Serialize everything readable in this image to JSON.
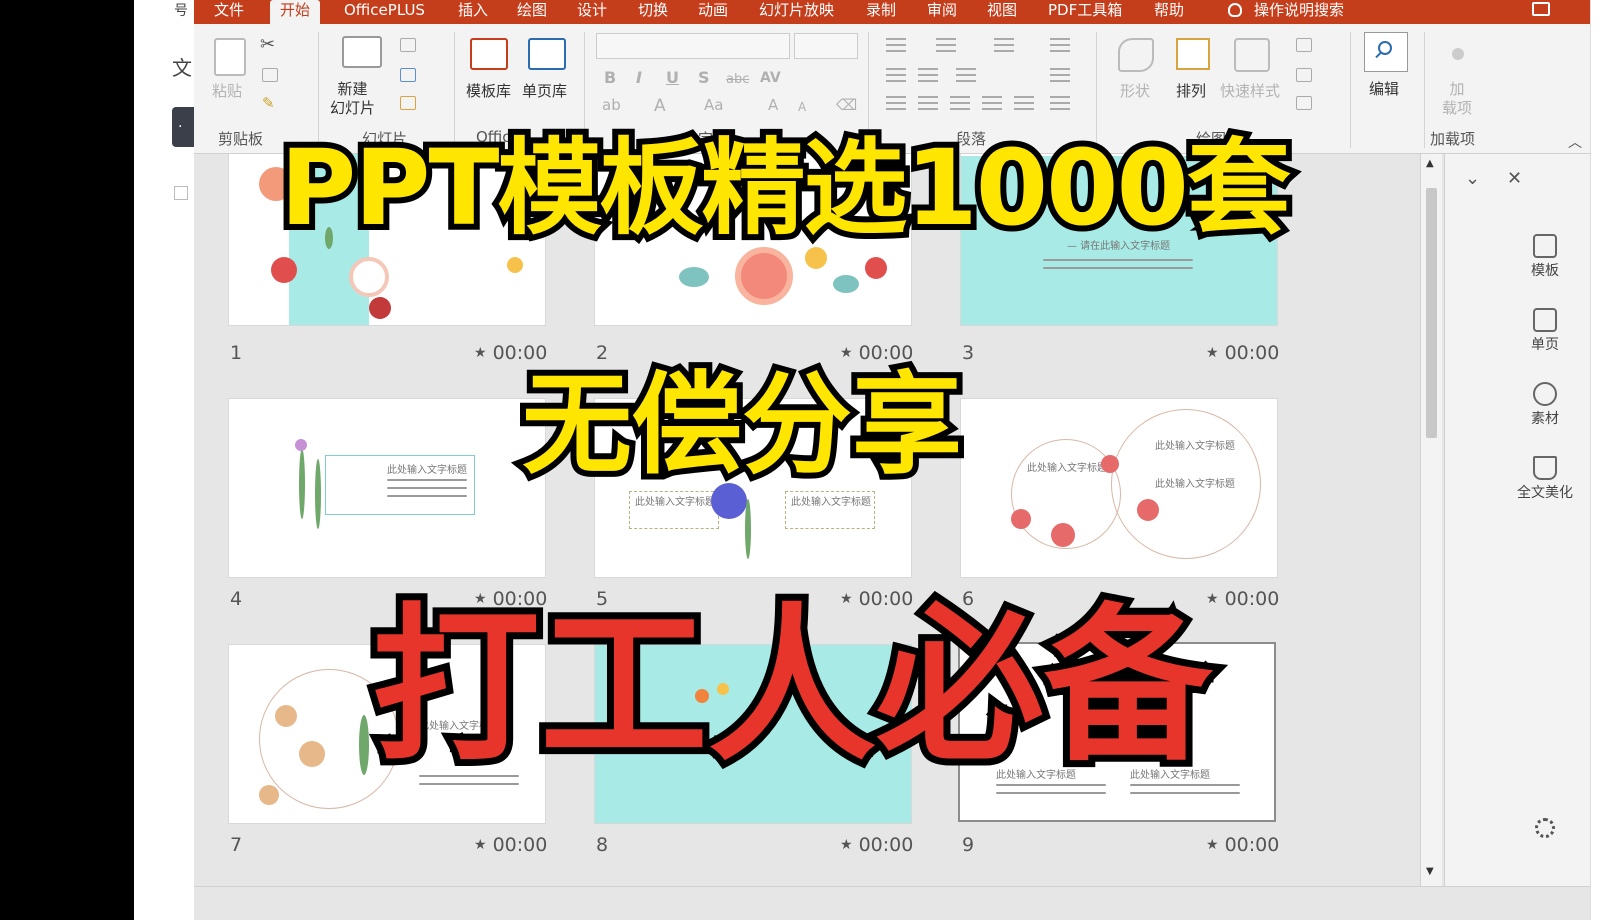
{
  "tabs": [
    "文件",
    "开始",
    "OfficePLUS",
    "插入",
    "绘图",
    "设计",
    "切换",
    "动画",
    "幻灯片放映",
    "录制",
    "审阅",
    "视图",
    "PDF工具箱",
    "帮助",
    "操作说明搜索"
  ],
  "ribbon": {
    "paste_label": "粘贴",
    "new_slide_label": "新建\n幻灯片",
    "template_lib_label": "模板库",
    "single_page_label": "单页库",
    "shapes_label": "形状",
    "arrange_label": "排列",
    "quick_styles_label": "快速样式",
    "edit_label": "编辑",
    "addins_label": "加\n载项",
    "groups": {
      "clipboard": "剪贴板",
      "slides": "幻灯片",
      "office": "Office",
      "font": "字体",
      "paragraph": "段落",
      "drawing": "绘图",
      "addins": "加载项"
    }
  },
  "left_panel": {
    "char": "文",
    "top_char": "号"
  },
  "slides": [
    {
      "num": "1",
      "time": "00:00"
    },
    {
      "num": "2",
      "time": "00:00"
    },
    {
      "num": "3",
      "time": "00:00"
    },
    {
      "num": "4",
      "time": "00:00"
    },
    {
      "num": "5",
      "time": "00:00"
    },
    {
      "num": "6",
      "time": "00:00"
    },
    {
      "num": "7",
      "time": "00:00"
    },
    {
      "num": "8",
      "time": "00:00"
    },
    {
      "num": "9",
      "time": "00:00"
    }
  ],
  "slide_texts": {
    "t3": "— 请在此输入文字标题",
    "t4": "此处输入文字标题",
    "t5a": "此处输入文字标题",
    "t5b": "此处输入文字标题",
    "t6a": "此处输入文字标题",
    "t6b": "此处输入文字标题",
    "t6c": "此处输入文字标题",
    "t7": "此处输入文字标题",
    "t9a": "此处输入文字标题",
    "t9b": "此处输入文字标题"
  },
  "side_pane": {
    "items": [
      "模板",
      "单页",
      "素材",
      "全文美化"
    ]
  },
  "overlay": {
    "line1": "PPT模板精选1000套",
    "line2": "无偿分享",
    "line3": "打工人必备"
  },
  "colors": {
    "tab_bar": "#c43e1c",
    "overlay_yellow": "#ffe600",
    "overlay_red": "#e8352b",
    "slide_teal": "#a8ebe6"
  }
}
